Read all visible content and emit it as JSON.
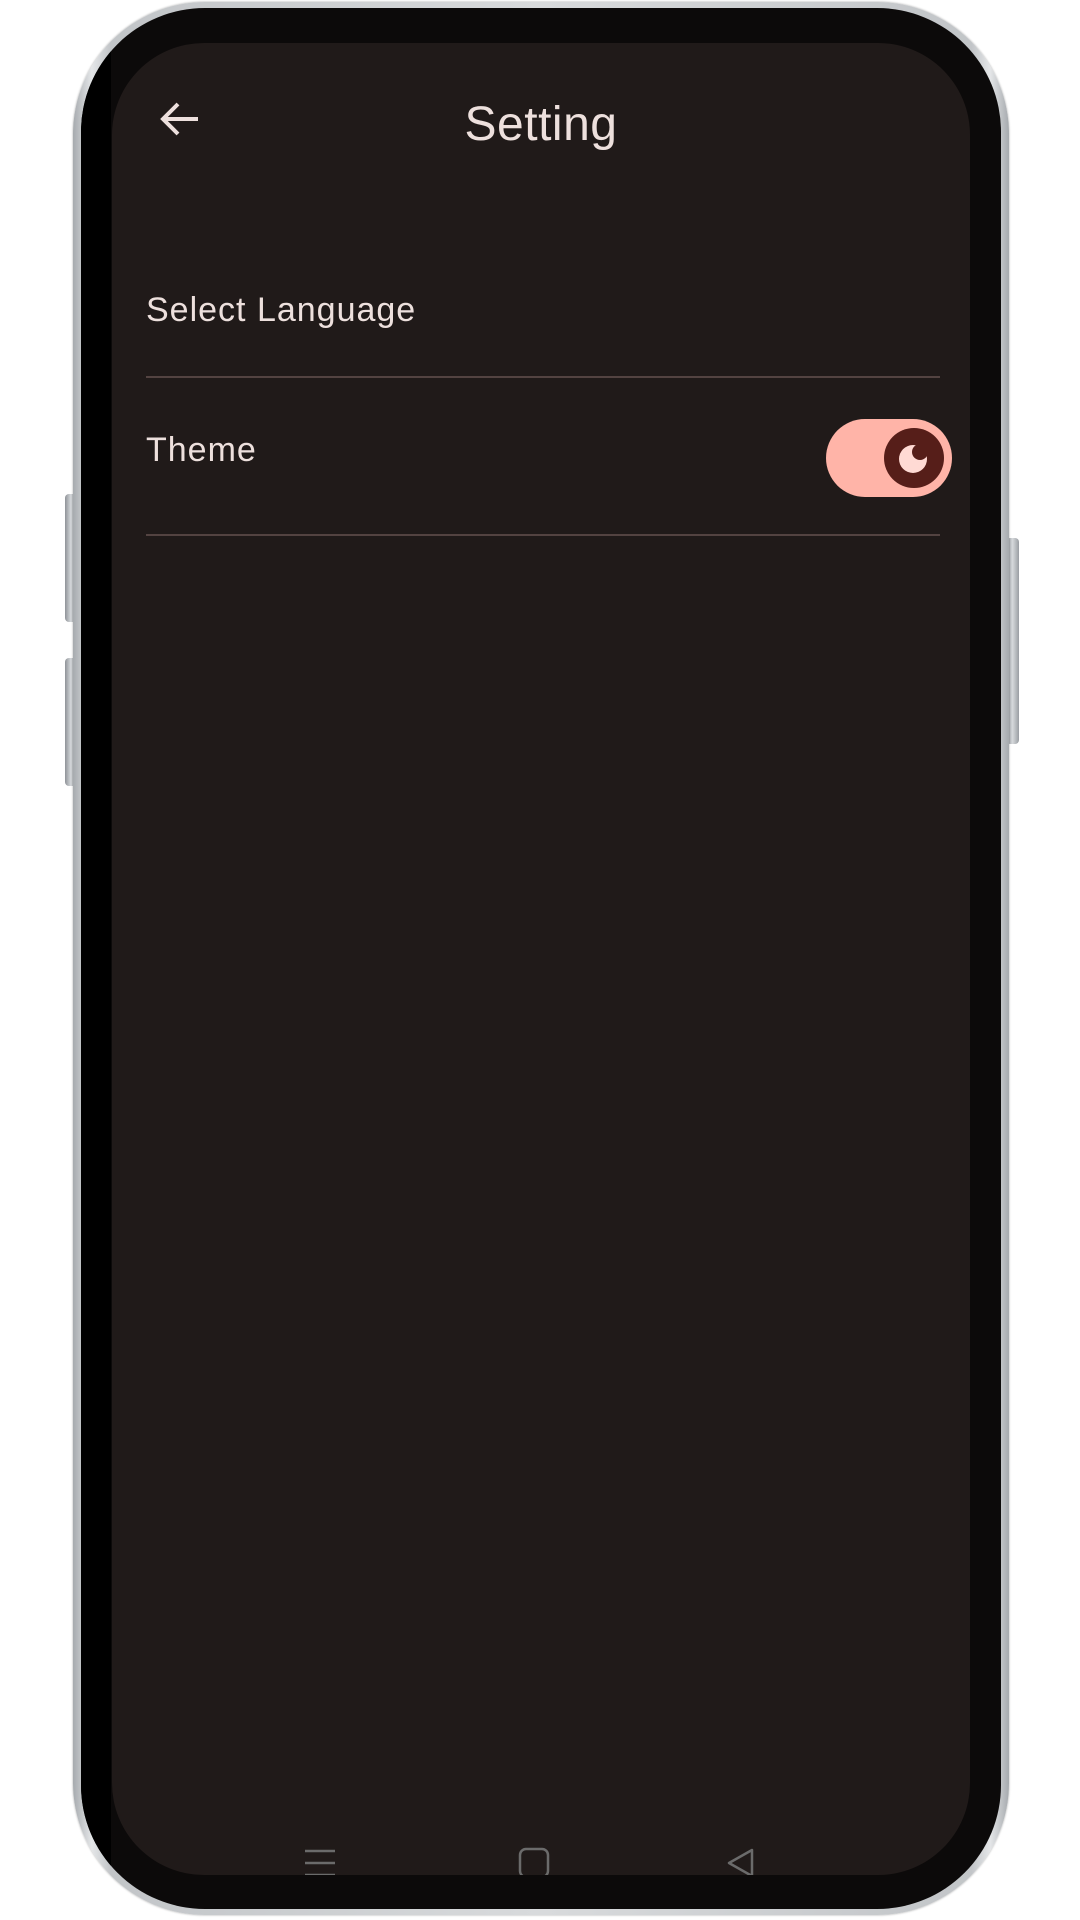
{
  "header": {
    "back_icon": "arrow-back-icon",
    "title": "Setting"
  },
  "settings": {
    "items": [
      {
        "label": "Select Language"
      },
      {
        "label": "Theme",
        "control": "toggle",
        "toggle_on": true,
        "thumb_icon": "moon-icon"
      }
    ]
  },
  "nav_bar": {
    "icons": [
      "menu-icon",
      "home-square-icon",
      "back-triangle-icon"
    ]
  },
  "colors": {
    "background": "#201a19",
    "text": "#ede0dd",
    "divider": "#534341",
    "switch_track": "#ffb4a8",
    "switch_thumb": "#561e19",
    "nav_icon": "#6b6b6b"
  }
}
